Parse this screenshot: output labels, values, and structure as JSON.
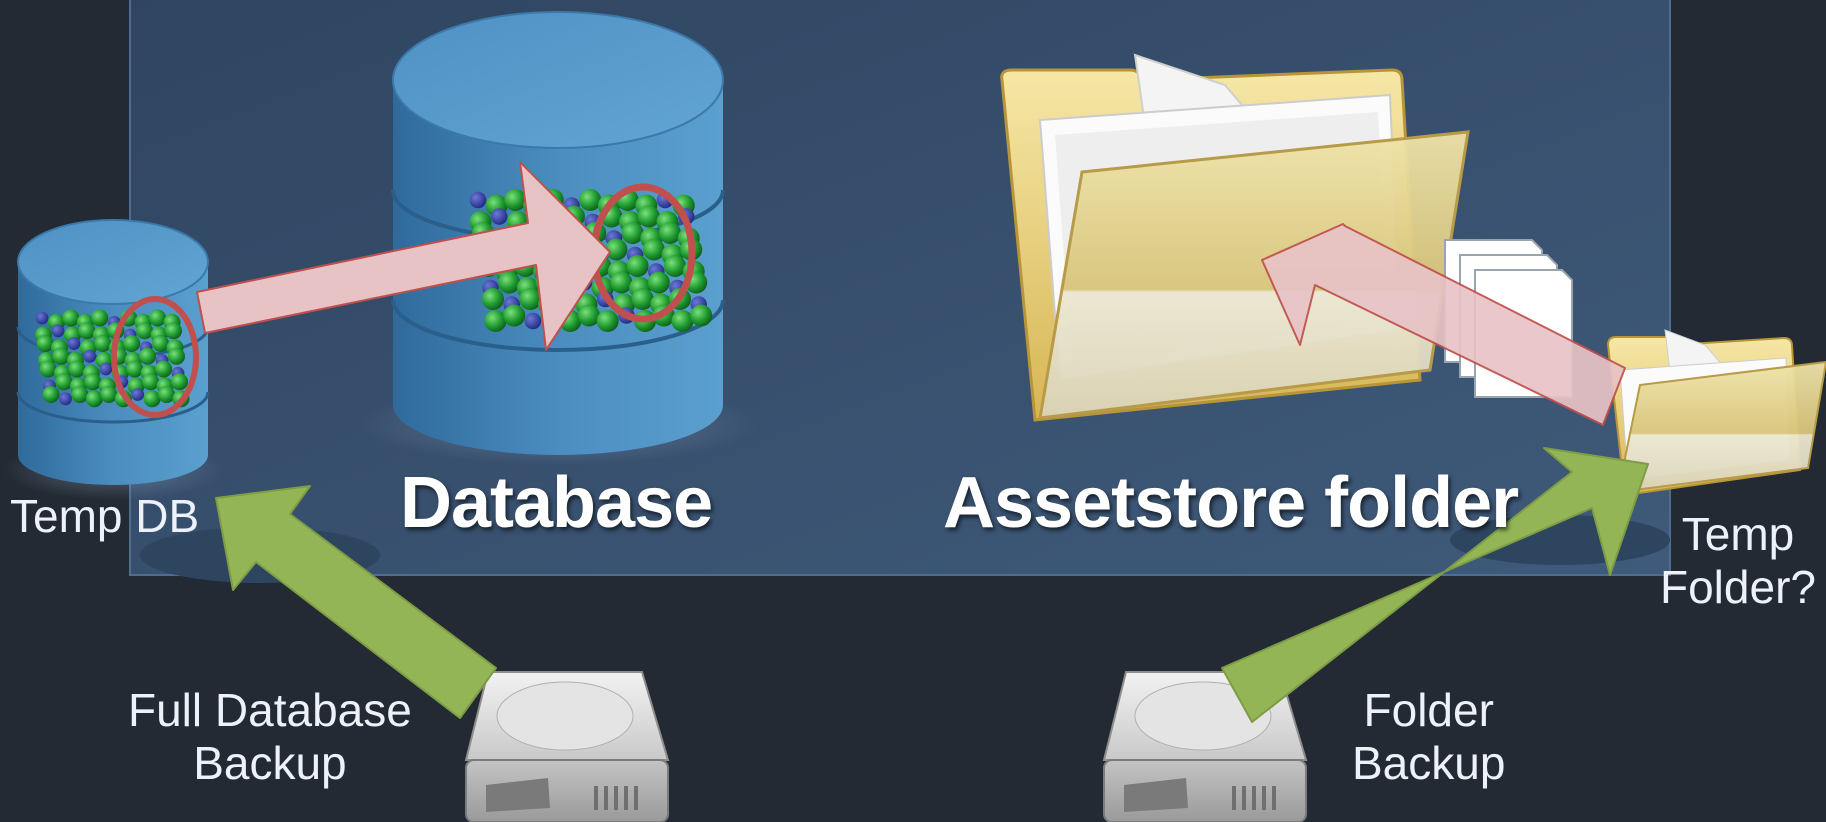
{
  "labels": {
    "database": "Database",
    "assetstore": "Assetstore folder",
    "temp_db": "Temp DB",
    "temp_folder_line1": "Temp",
    "temp_folder_line2": "Folder?",
    "full_backup_line1": "Full Database",
    "full_backup_line2": "Backup",
    "folder_backup_line1": "Folder",
    "folder_backup_line2": "Backup"
  },
  "colors": {
    "background": "#232a33",
    "panel": "#36506e",
    "cylinder": "#4a8bbd",
    "data_arrow": "#e8c3c6",
    "backup_arrow": "#93b556",
    "highlight_ring": "#c0504d"
  }
}
